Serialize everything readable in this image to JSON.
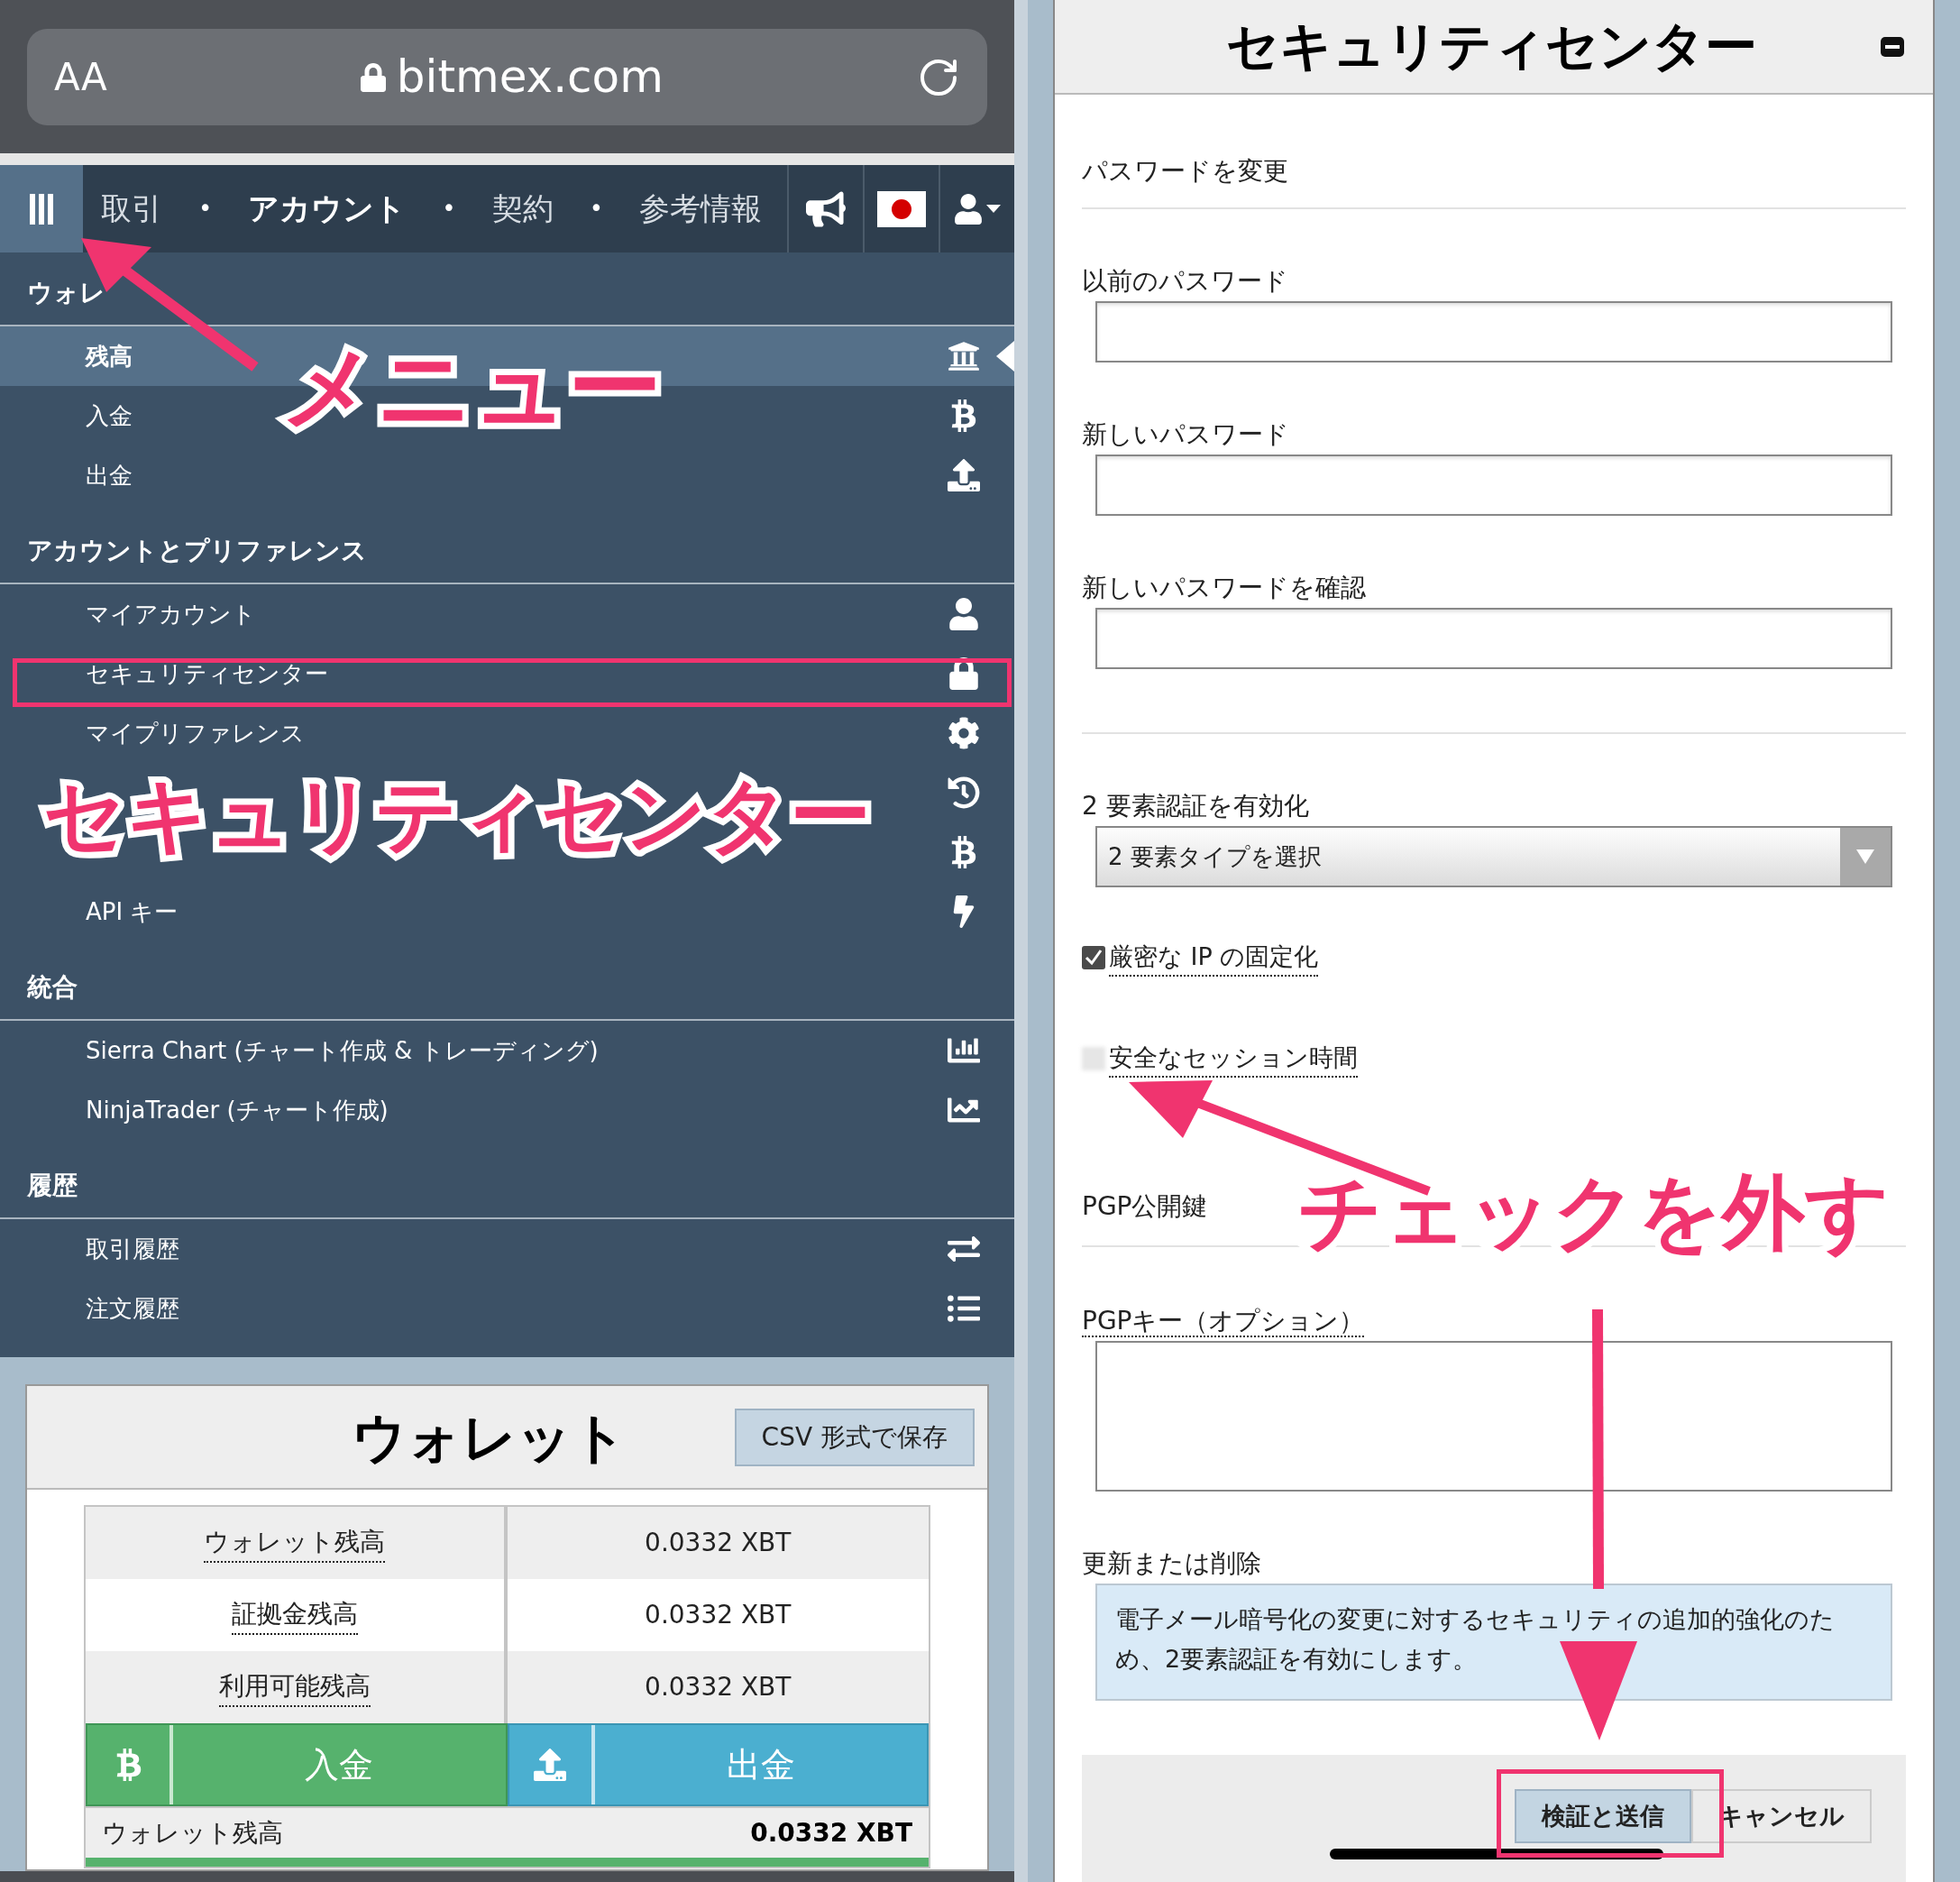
{
  "browser": {
    "text_size_button": "AA",
    "url": "bitmex.com"
  },
  "nav": {
    "items": [
      {
        "label": "取引",
        "selected": false
      },
      {
        "label": "アカウント",
        "selected": true
      },
      {
        "label": "契約",
        "selected": false
      },
      {
        "label": "参考情報",
        "selected": false
      }
    ],
    "separators": [
      "•",
      "•",
      "•"
    ]
  },
  "sidebar": {
    "sections": [
      {
        "title": "ウォレ",
        "items": [
          {
            "label": "残高",
            "selected": true
          },
          {
            "label": "入金",
            "selected": false
          },
          {
            "label": "出金",
            "selected": false
          }
        ]
      },
      {
        "title": "アカウントとプリファレンス",
        "items": [
          {
            "label": "マイアカウント",
            "selected": false
          },
          {
            "label": "セキュリティセンター",
            "selected": false
          },
          {
            "label": "マイプリファレンス",
            "selected": false
          },
          {
            "selected": false
          },
          {
            "selected": false
          },
          {
            "label": "API キー",
            "selected": false
          }
        ]
      },
      {
        "title": "統合",
        "items": [
          {
            "label": "Sierra Chart (チャート作成 & トレーディング)",
            "selected": false
          },
          {
            "label": "NinjaTrader (チャート作成)",
            "selected": false
          }
        ]
      },
      {
        "title": "履歴",
        "items": [
          {
            "label": "取引履歴",
            "selected": false
          },
          {
            "label": "注文履歴",
            "selected": false
          }
        ]
      }
    ]
  },
  "wallet": {
    "title": "ウォレット",
    "export_button": "CSV 形式で保存",
    "rows": [
      {
        "label": "ウォレット残高",
        "value": "0.0332 XBT"
      },
      {
        "label": "証拠金残高",
        "value": "0.0332 XBT"
      },
      {
        "label": "利用可能残高",
        "value": "0.0332 XBT"
      }
    ],
    "deposit_button": "入金",
    "withdraw_button": "出金",
    "footer": {
      "label": "ウォレット残高",
      "value": "0.0332 XBT"
    }
  },
  "security": {
    "title": "セキュリティセンター",
    "password_section": "パスワードを変更",
    "fields": [
      {
        "label": "以前のパスワード"
      },
      {
        "label": "新しいパスワード"
      },
      {
        "label": "新しいパスワードを確認"
      }
    ],
    "two_factor": {
      "label": "2 要素認証を有効化",
      "value": "2 要素タイプを選択"
    },
    "options": [
      {
        "label": "厳密な IP の固定化",
        "checked": true
      },
      {
        "label": "安全なセッション時間",
        "checked": false
      }
    ],
    "pgp_section": "PGP公開鍵",
    "pgp_key": {
      "label": "PGPキー（オプション）"
    },
    "update": {
      "label": "更新または削除",
      "notice": "電子メール暗号化の変更に対するセキュリティの追加的強化のため、2要素認証を有効にします。"
    },
    "buttons": [
      {
        "label": "検証と送信",
        "kind": "primary"
      },
      {
        "label": "キャンセル",
        "kind": "secondary"
      }
    ]
  },
  "annotations": [
    {
      "text": "メニュー"
    },
    {
      "text": "セキュリティセンター"
    },
    {
      "text": "チェックを外す"
    }
  ]
}
